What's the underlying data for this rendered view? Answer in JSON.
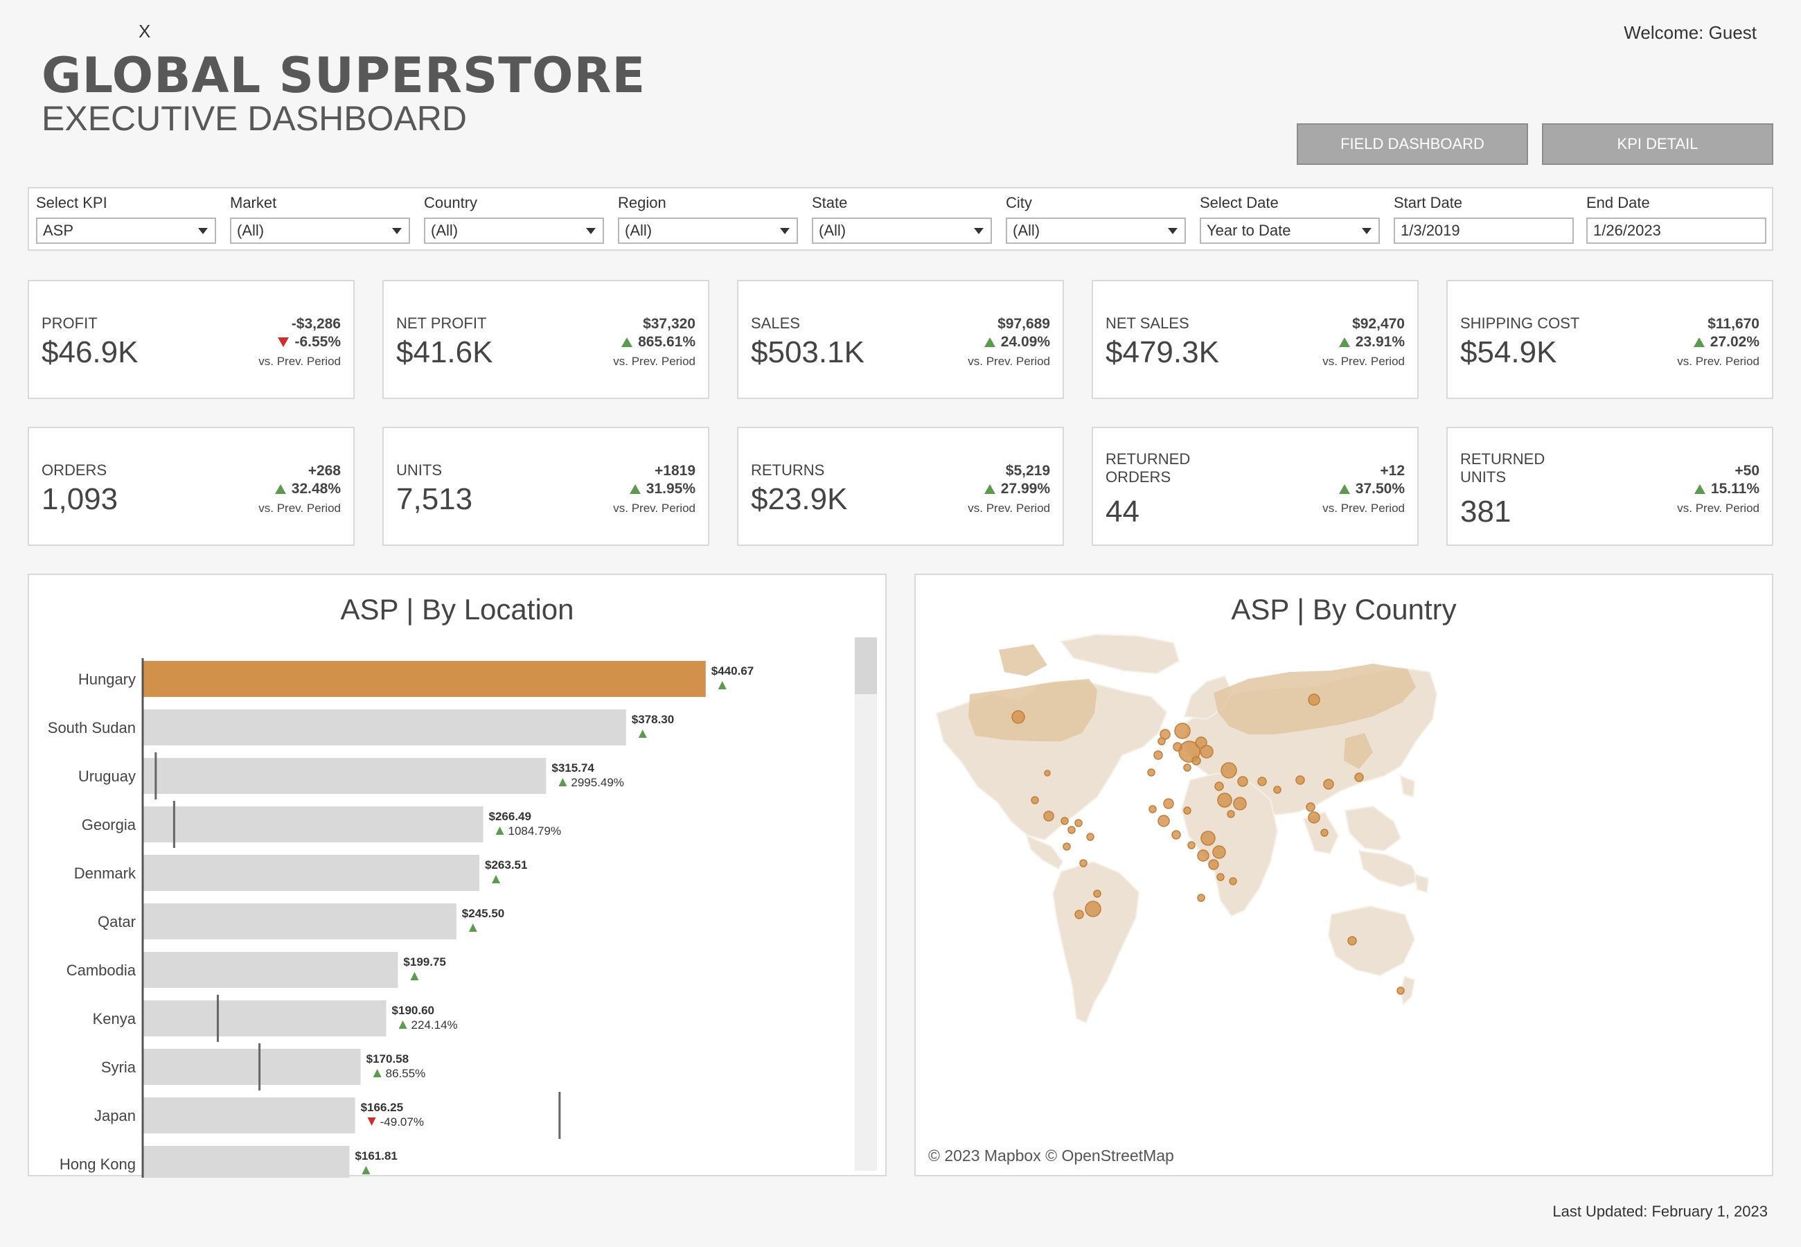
{
  "header": {
    "close_label": "X",
    "welcome": "Welcome: Guest",
    "title": "GLOBAL SUPERSTORE",
    "subtitle": "EXECUTIVE DASHBOARD",
    "nav_field": "FIELD DASHBOARD",
    "nav_kpi": "KPI DETAIL"
  },
  "filters": [
    {
      "label": "Select KPI",
      "value": "ASP",
      "type": "select"
    },
    {
      "label": "Market",
      "value": "(All)",
      "type": "select"
    },
    {
      "label": "Country",
      "value": "(All)",
      "type": "select"
    },
    {
      "label": "Region",
      "value": "(All)",
      "type": "select"
    },
    {
      "label": "State",
      "value": "(All)",
      "type": "select"
    },
    {
      "label": "City",
      "value": "(All)",
      "type": "select"
    },
    {
      "label": "Select Date",
      "value": "Year to Date",
      "type": "select"
    },
    {
      "label": "Start Date",
      "value": "1/3/2019",
      "type": "input"
    },
    {
      "label": "End Date",
      "value": "1/26/2023",
      "type": "input"
    }
  ],
  "kpis": [
    {
      "label": "PROFIT",
      "value": "$46.9K",
      "delta": "-$3,286",
      "pct": "-6.55%",
      "dir": "down",
      "vs": "vs. Prev. Period"
    },
    {
      "label": "NET PROFIT",
      "value": "$41.6K",
      "delta": "$37,320",
      "pct": "865.61%",
      "dir": "up",
      "vs": "vs. Prev. Period"
    },
    {
      "label": "SALES",
      "value": "$503.1K",
      "delta": "$97,689",
      "pct": "24.09%",
      "dir": "up",
      "vs": "vs. Prev. Period"
    },
    {
      "label": "NET SALES",
      "value": "$479.3K",
      "delta": "$92,470",
      "pct": "23.91%",
      "dir": "up",
      "vs": "vs. Prev. Period"
    },
    {
      "label": "SHIPPING COST",
      "value": "$54.9K",
      "delta": "$11,670",
      "pct": "27.02%",
      "dir": "up",
      "vs": "vs. Prev. Period"
    },
    {
      "label": "ORDERS",
      "value": "1,093",
      "delta": "+268",
      "pct": "32.48%",
      "dir": "up",
      "vs": "vs. Prev. Period"
    },
    {
      "label": "UNITS",
      "value": "7,513",
      "delta": "+1819",
      "pct": "31.95%",
      "dir": "up",
      "vs": "vs. Prev. Period"
    },
    {
      "label": "RETURNS",
      "value": "$23.9K",
      "delta": "$5,219",
      "pct": "27.99%",
      "dir": "up",
      "vs": "vs. Prev. Period"
    },
    {
      "label": "RETURNED ORDERS",
      "value": "44",
      "delta": "+12",
      "pct": "37.50%",
      "dir": "up",
      "vs": "vs. Prev. Period"
    },
    {
      "label": "RETURNED UNITS",
      "value": "381",
      "delta": "+50",
      "pct": "15.11%",
      "dir": "up",
      "vs": "vs. Prev. Period"
    }
  ],
  "location_panel": {
    "title": "ASP | By Location"
  },
  "country_panel": {
    "title": "ASP | By Country",
    "attribution": "© 2023 Mapbox  © OpenStreetMap"
  },
  "colors": {
    "highlight_bar": "#d2914b",
    "bar": "#d9d9d9",
    "up": "#5a9b4f",
    "down": "#d02d2d",
    "map_land": "#e9d9c4",
    "map_bubble": "#d2914b"
  },
  "chart_data": {
    "type": "bar",
    "orientation": "horizontal",
    "title": "ASP | By Location",
    "categories": [
      "Hungary",
      "South Sudan",
      "Uruguay",
      "Georgia",
      "Denmark",
      "Qatar",
      "Cambodia",
      "Kenya",
      "Syria",
      "Japan",
      "Hong Kong"
    ],
    "values": [
      440.67,
      378.3,
      315.74,
      266.49,
      263.51,
      245.5,
      199.75,
      190.6,
      170.58,
      166.25,
      161.81
    ],
    "value_labels": [
      "$440.67",
      "$378.30",
      "$315.74",
      "$266.49",
      "$263.51",
      "$245.50",
      "$199.75",
      "$190.60",
      "$170.58",
      "$166.25",
      "$161.81"
    ],
    "change_labels": [
      "",
      "",
      "2995.49%",
      "1084.79%",
      "",
      "",
      "",
      "224.14%",
      "86.55%",
      "-49.07%",
      ""
    ],
    "change_dir": [
      "up",
      "up",
      "up",
      "up",
      "up",
      "up",
      "up",
      "up",
      "up",
      "down",
      "up"
    ],
    "prev_period_values": [
      null,
      null,
      10.2,
      24.6,
      null,
      null,
      null,
      58.8,
      91.4,
      326.3,
      null
    ],
    "highlight_index": 0,
    "xlim": [
      0,
      450
    ]
  }
}
